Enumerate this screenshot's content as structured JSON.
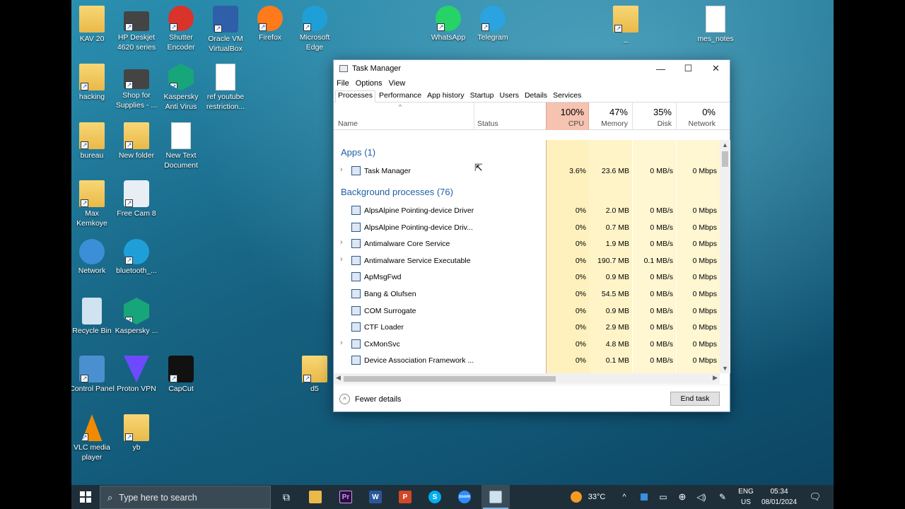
{
  "desktop": {
    "icons": [
      {
        "label": "KAV 20"
      },
      {
        "label": "HP Deskjet 4620 series"
      },
      {
        "label": "Shutter Encoder"
      },
      {
        "label": "Oracle VM VirtualBox"
      },
      {
        "label": "Firefox"
      },
      {
        "label": "Microsoft Edge"
      },
      {
        "label": "WhatsApp"
      },
      {
        "label": "Telegram"
      },
      {
        "label": "_"
      },
      {
        "label": "mes_notes"
      },
      {
        "label": "hacking"
      },
      {
        "label": "Shop for Supplies - ..."
      },
      {
        "label": "Kaspersky Anti Virus"
      },
      {
        "label": "ref youtube restriction..."
      },
      {
        "label": "bureau"
      },
      {
        "label": "New folder"
      },
      {
        "label": "New Text Document"
      },
      {
        "label": "Max Kemkoye"
      },
      {
        "label": "Free Cam 8"
      },
      {
        "label": "Network"
      },
      {
        "label": "bluetooth_..."
      },
      {
        "label": "Recycle Bin"
      },
      {
        "label": "Kaspersky ..."
      },
      {
        "label": "Control Panel"
      },
      {
        "label": "Proton VPN"
      },
      {
        "label": "CapCut"
      },
      {
        "label": "d5"
      },
      {
        "label": "VLC media player"
      },
      {
        "label": "yb"
      }
    ]
  },
  "task_manager": {
    "title": "Task Manager",
    "menu": [
      "File",
      "Options",
      "View"
    ],
    "tabs": [
      "Processes",
      "Performance",
      "App history",
      "Startup",
      "Users",
      "Details",
      "Services"
    ],
    "active_tab": "Processes",
    "columns": {
      "name": "Name",
      "status": "Status",
      "cpu": {
        "label": "CPU",
        "pct": "100%"
      },
      "memory": {
        "label": "Memory",
        "pct": "47%"
      },
      "disk": {
        "label": "Disk",
        "pct": "35%"
      },
      "network": {
        "label": "Network",
        "pct": "0%"
      }
    },
    "groups": {
      "apps": "Apps (1)",
      "background": "Background processes (76)"
    },
    "apps": [
      {
        "name": "Task Manager",
        "cpu": "3.6%",
        "memory": "23.6 MB",
        "disk": "0 MB/s",
        "network": "0 Mbps"
      }
    ],
    "background": [
      {
        "name": "AlpsAlpine Pointing-device Driver",
        "cpu": "0%",
        "memory": "2.0 MB",
        "disk": "0 MB/s",
        "network": "0 Mbps"
      },
      {
        "name": "AlpsAlpine Pointing-device Driv...",
        "cpu": "0%",
        "memory": "0.7 MB",
        "disk": "0 MB/s",
        "network": "0 Mbps"
      },
      {
        "name": "Antimalware Core Service",
        "cpu": "0%",
        "memory": "1.9 MB",
        "disk": "0 MB/s",
        "network": "0 Mbps"
      },
      {
        "name": "Antimalware Service Executable",
        "cpu": "0%",
        "memory": "190.7 MB",
        "disk": "0.1 MB/s",
        "network": "0 Mbps"
      },
      {
        "name": "ApMsgFwd",
        "cpu": "0%",
        "memory": "0.9 MB",
        "disk": "0 MB/s",
        "network": "0 Mbps"
      },
      {
        "name": "Bang & Olufsen",
        "cpu": "0%",
        "memory": "54.5 MB",
        "disk": "0 MB/s",
        "network": "0 Mbps"
      },
      {
        "name": "COM Surrogate",
        "cpu": "0%",
        "memory": "0.9 MB",
        "disk": "0 MB/s",
        "network": "0 Mbps"
      },
      {
        "name": "CTF Loader",
        "cpu": "0%",
        "memory": "2.9 MB",
        "disk": "0 MB/s",
        "network": "0 Mbps"
      },
      {
        "name": "CxMonSvc",
        "cpu": "0%",
        "memory": "4.8 MB",
        "disk": "0 MB/s",
        "network": "0 Mbps"
      },
      {
        "name": "Device Association Framework ...",
        "cpu": "0%",
        "memory": "0.1 MB",
        "disk": "0 MB/s",
        "network": "0 Mbps"
      }
    ],
    "fewer_details": "Fewer details",
    "end_task": "End task"
  },
  "taskbar": {
    "search_placeholder": "Type here to search",
    "weather": "33°C",
    "lang1": "ENG",
    "lang2": "US",
    "time": "05:34",
    "date": "08/01/2024"
  },
  "colors": {
    "cpu_header": "#f5c3b0",
    "heat_col": "#fff4c4",
    "heat_col_light": "#fff8d9",
    "group_text": "#1f5fa7"
  }
}
